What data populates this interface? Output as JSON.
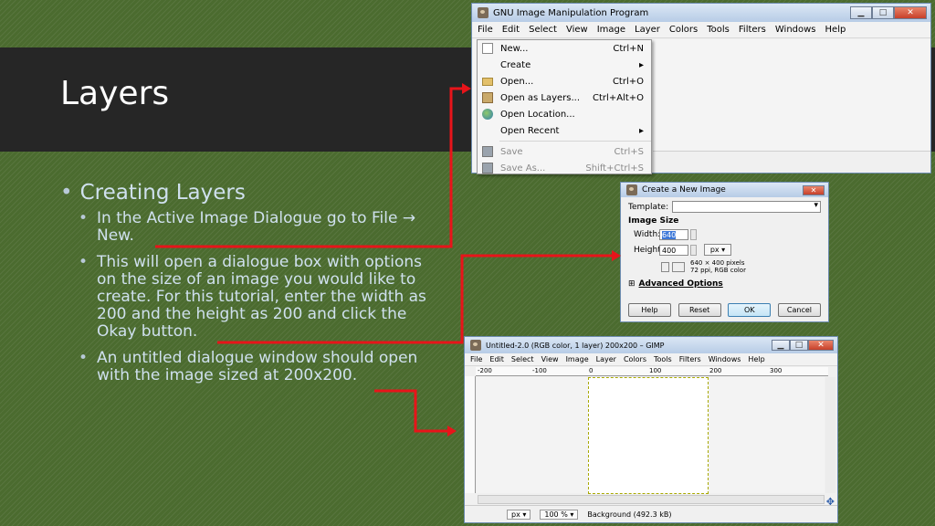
{
  "slide": {
    "title": "Layers",
    "bullets": {
      "main": "Creating Layers",
      "items": [
        "In the Active Image Dialogue go to File → New.",
        "This will open a dialogue box with options on the size of an image you would like to create. For this tutorial, enter the width as 200 and the height as 200 and click the Okay button.",
        "An untitled dialogue window should open with the image sized at 200x200."
      ]
    }
  },
  "gimp_main": {
    "title": "GNU Image Manipulation Program",
    "menu": [
      "File",
      "Edit",
      "Select",
      "View",
      "Image",
      "Layer",
      "Colors",
      "Tools",
      "Filters",
      "Windows",
      "Help"
    ]
  },
  "file_menu": {
    "items": [
      {
        "label": "New...",
        "shortcut": "Ctrl+N",
        "icon": "new-file-icon"
      },
      {
        "label": "Create",
        "shortcut": "▸",
        "icon": ""
      },
      {
        "label": "Open...",
        "shortcut": "Ctrl+O",
        "icon": "folder-icon"
      },
      {
        "label": "Open as Layers...",
        "shortcut": "Ctrl+Alt+O",
        "icon": "layers-icon"
      },
      {
        "label": "Open Location...",
        "shortcut": "",
        "icon": "globe-icon"
      },
      {
        "label": "Open Recent",
        "shortcut": "▸",
        "icon": ""
      },
      {
        "label": "Save",
        "shortcut": "Ctrl+S",
        "icon": "save-icon"
      },
      {
        "label": "Save As...",
        "shortcut": "Shift+Ctrl+S",
        "icon": "save-as-icon"
      }
    ]
  },
  "new_dialog": {
    "title": "Create a New Image",
    "template_label": "Template:",
    "image_size_label": "Image Size",
    "width_label": "Width:",
    "width_value": "640",
    "height_label": "Height:",
    "height_value": "400",
    "unit": "px ▾",
    "info_line1": "640 × 400 pixels",
    "info_line2": "72 ppi, RGB color",
    "advanced_label": "Advanced Options",
    "buttons": {
      "help": "Help",
      "reset": "Reset",
      "ok": "OK",
      "cancel": "Cancel"
    }
  },
  "untitled_win": {
    "title": "Untitled-2.0 (RGB color, 1 layer) 200x200 – GIMP",
    "menu": [
      "File",
      "Edit",
      "Select",
      "View",
      "Image",
      "Layer",
      "Colors",
      "Tools",
      "Filters",
      "Windows",
      "Help"
    ],
    "ruler_labels": [
      "-200",
      "-100",
      "0",
      "100",
      "200",
      "300"
    ],
    "status_unit": "px ▾",
    "zoom": "100 % ▾",
    "status_text": "Background (492.3 kB)"
  },
  "colors": {
    "arrow": "#e8141a",
    "title_band": "#262626",
    "background": "#4b6b2f",
    "text": "#cfe0ee"
  }
}
